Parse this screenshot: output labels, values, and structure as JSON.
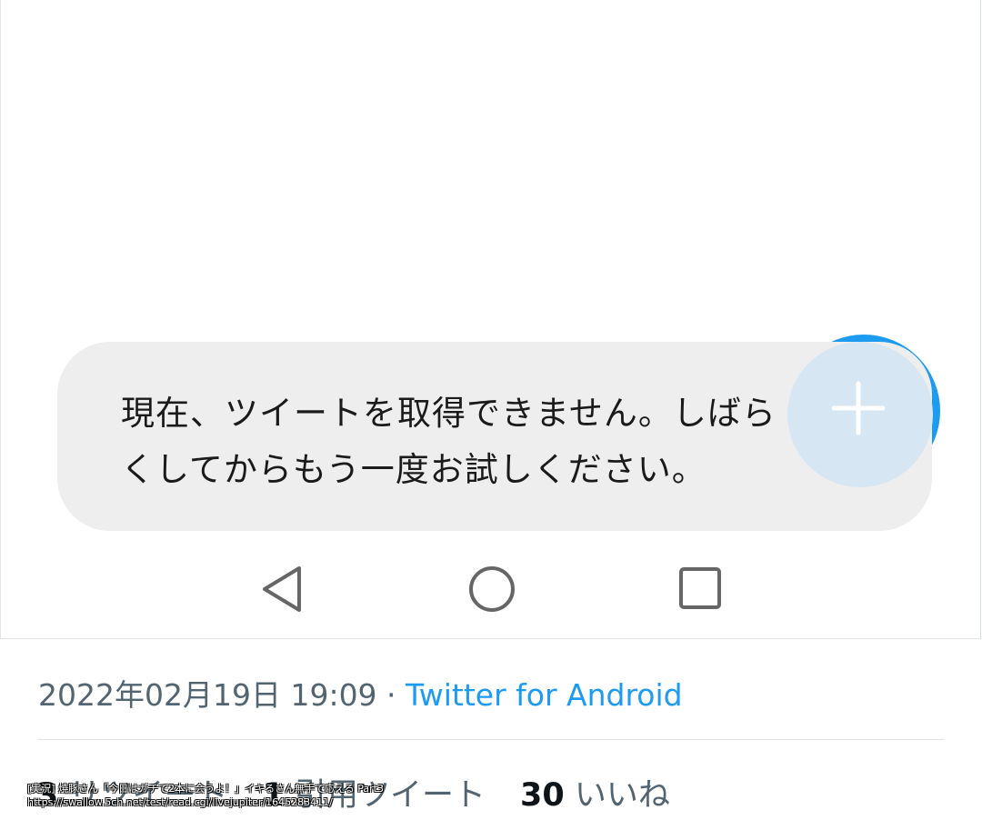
{
  "toast": {
    "message": "現在、ツイートを取得できません。しばら\nくしてからもう一度お試しください。"
  },
  "fab": {
    "icon": "plus-icon",
    "color": "#1d9bf0"
  },
  "navbar": {
    "back_icon": "triangle-back-icon",
    "home_icon": "circle-home-icon",
    "recent_icon": "square-recent-icon"
  },
  "tweet_meta": {
    "datetime": "2022年02月19日 19:09",
    "separator": " · ",
    "source": "Twitter for Android"
  },
  "stats": {
    "retweets_count": "3",
    "retweets_label": "リツイート",
    "quotes_count": "1",
    "quotes_label": "引用ツイート",
    "likes_count": "30",
    "likes_label": "いいね"
  },
  "watermark": {
    "line1": "[実況] 焼豚さん「今日はガチで2本に会うよ！」イキるさん無手で応える Part3",
    "line2": "https://swallow.5ch.net/test/read.cgi/livejupiter/1645283411/"
  },
  "colors": {
    "accent": "#1d9bf0",
    "muted_text": "#536471",
    "toast_bg": "#eeeeee"
  }
}
